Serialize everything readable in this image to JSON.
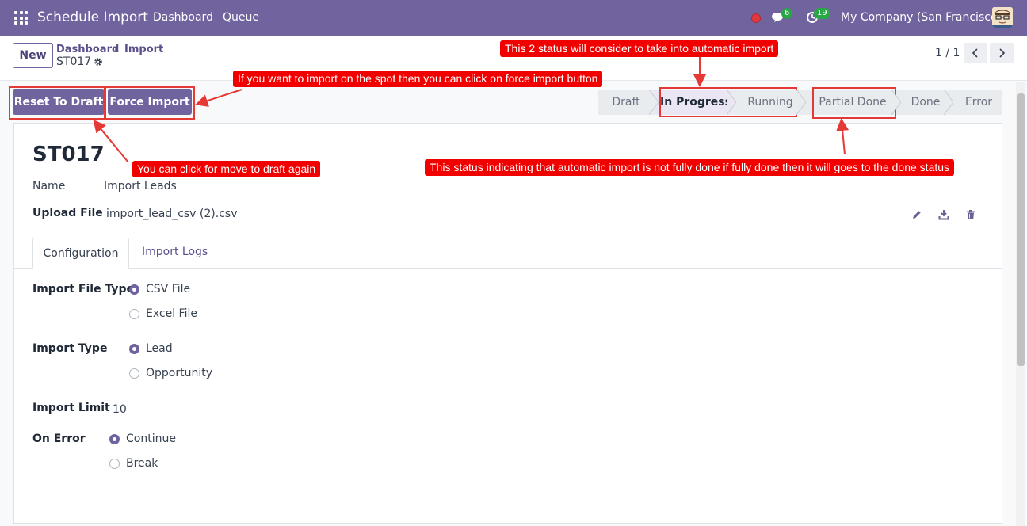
{
  "navbar": {
    "brand": "Schedule Import",
    "links": [
      "Dashboard",
      "Queue"
    ],
    "chat_badge": "6",
    "activity_badge": "19",
    "company": "My Company (San Francisco)"
  },
  "control": {
    "new_label": "New",
    "breadcrumb": [
      "Dashboard",
      "Import"
    ],
    "breadcrumb_sep": "/",
    "record": "ST017",
    "pager": "1 / 1"
  },
  "actions": {
    "reset": "Reset To Draft",
    "force": "Force Import"
  },
  "statusbar": {
    "stages": [
      "Draft",
      "In Progress",
      "Running",
      "Partial Done",
      "Done",
      "Error"
    ],
    "active": "In Progress"
  },
  "form": {
    "title": "ST017",
    "name_label": "Name",
    "name_value": "Import Leads",
    "upload_label": "Upload File",
    "upload_value": "import_lead_csv (2).csv",
    "tabs": [
      "Configuration",
      "Import Logs"
    ],
    "file_type_label": "Import File Type",
    "file_type_options": [
      "CSV File",
      "Excel File"
    ],
    "import_type_label": "Import Type",
    "import_type_options": [
      "Lead",
      "Opportunity"
    ],
    "limit_label": "Import Limit",
    "limit_value": "10",
    "on_error_label": "On Error",
    "on_error_options": [
      "Continue",
      "Break"
    ]
  },
  "annotations": {
    "status_note": "This 2 status will consider to take into automatic import",
    "force_note": "If you want to import on the spot then you can click on force import button",
    "draft_note": "You can click for move to draft again",
    "partial_note": "This status indicating that automatic import is not fully done if fully done then it will goes to the done status"
  },
  "colors": {
    "brand": "#71639e",
    "annotation": "#f20000",
    "badge": "#28a745"
  }
}
